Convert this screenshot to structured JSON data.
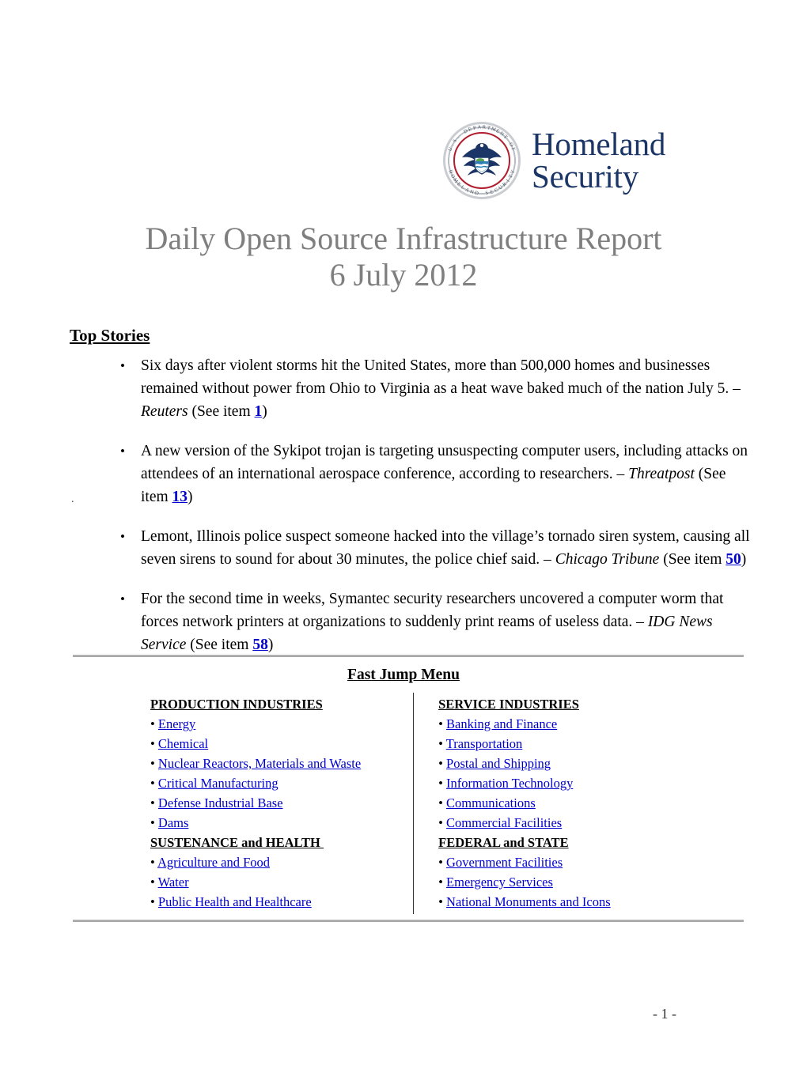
{
  "header": {
    "seal_name": "dhs-seal",
    "seal_ring_text_top": "U.S. DEPARTMENT OF",
    "seal_ring_text_bottom": "HOMELAND SECURITY",
    "wordmark_line1": "Homeland",
    "wordmark_line2": "Security",
    "wordmark_color": "#1b3666"
  },
  "title": {
    "line1": "Daily Open Source Infrastructure Report",
    "line2": "6 July 2012",
    "color": "#7f7f7f"
  },
  "top_stories": {
    "heading": "Top Stories",
    "bullet_glyph": "•",
    "items": [
      {
        "text_before": "Six days after violent storms hit the United States, more than 500,000 homes and businesses remained without power from Ohio to Virginia as a heat wave baked much of the nation July 5. – ",
        "source": "Reuters",
        "see_prefix": " (See item ",
        "item_number": "1",
        "see_suffix": ")"
      },
      {
        "text_before": "A new version of the Sykipot trojan is targeting unsuspecting computer users, including attacks on attendees of an international aerospace conference, according to researchers. – ",
        "source": "Threatpost",
        "see_prefix": " (See item ",
        "item_number": "13",
        "see_suffix": ")"
      },
      {
        "text_before": "Lemont, Illinois police suspect someone hacked into the village’s tornado siren system, causing all seven sirens to sound for about 30 minutes, the police chief said. – ",
        "source": "Chicago Tribune",
        "see_prefix": " (See item ",
        "item_number": "50",
        "see_suffix": ")"
      },
      {
        "text_before": "For the second time in weeks, Symantec security researchers uncovered a computer worm that forces network printers at organizations to suddenly print reams of useless data. – ",
        "source": "IDG News Service",
        "see_prefix": " (See item ",
        "item_number": "58",
        "see_suffix": ")"
      }
    ],
    "stray_mark": "."
  },
  "fast_jump_menu": {
    "heading": "Fast Jump Menu",
    "link_color": "#0000cc",
    "bullet_glyph": "•",
    "left_column": [
      {
        "type": "group",
        "label": "PRODUCTION INDUSTRIES"
      },
      {
        "type": "link",
        "label": "Energy "
      },
      {
        "type": "link",
        "label": "Chemical "
      },
      {
        "type": "link",
        "label": "Nuclear Reactors, Materials and Waste "
      },
      {
        "type": "link",
        "label": "Critical Manufacturing "
      },
      {
        "type": "link",
        "label": "Defense Industrial Base "
      },
      {
        "type": "link",
        "label": "Dams "
      },
      {
        "type": "group",
        "label": "SUSTENANCE and HEALTH "
      },
      {
        "type": "link",
        "label": "Agriculture and Food "
      },
      {
        "type": "link",
        "label": "Water "
      },
      {
        "type": "link",
        "label": "Public Health and Healthcare "
      }
    ],
    "right_column": [
      {
        "type": "group",
        "label": "SERVICE INDUSTRIES"
      },
      {
        "type": "link",
        "label": "Banking and Finance "
      },
      {
        "type": "link",
        "label": "Transportation "
      },
      {
        "type": "link",
        "label": "Postal and Shipping "
      },
      {
        "type": "link",
        "label": "Information Technology "
      },
      {
        "type": "link",
        "label": "Communications "
      },
      {
        "type": "link",
        "label": "Commercial Facilities "
      },
      {
        "type": "group",
        "label": "FEDERAL and STATE"
      },
      {
        "type": "link",
        "label": "Government Facilities "
      },
      {
        "type": "link",
        "label": "Emergency Services "
      },
      {
        "type": "link",
        "label": "National Monuments and Icons "
      }
    ]
  },
  "footer": {
    "page_number": "- 1 -"
  }
}
